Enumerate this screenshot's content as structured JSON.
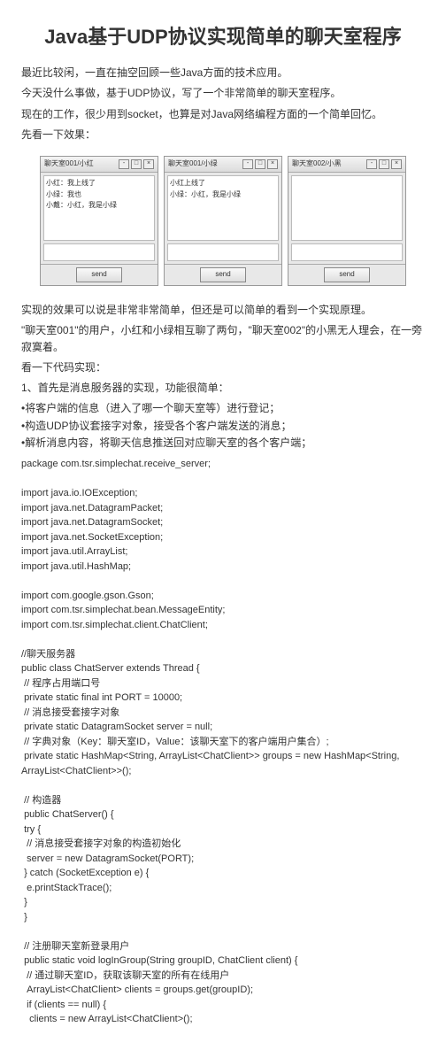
{
  "title": "Java基于UDP协议实现简单的聊天室程序",
  "intro": [
    "最近比较闲，一直在抽空回顾一些Java方面的技术应用。",
    "今天没什么事做，基于UDP协议，写了一个非常简单的聊天室程序。",
    "现在的工作，很少用到socket，也算是对Java网络编程方面的一个简单回忆。",
    "先看一下效果："
  ],
  "wins": [
    {
      "title": "聊天室001/小红",
      "lines": [
        "小红：我上线了",
        "小绿：我也",
        "小戴：小红，我是小绿"
      ]
    },
    {
      "title": "聊天室001/小绿",
      "lines": [
        "小红上线了",
        "小绿：小红，我是小绿"
      ]
    },
    {
      "title": "聊天室002/小黑",
      "lines": [
        ""
      ]
    }
  ],
  "sendLabel": "send",
  "after": [
    "实现的效果可以说是非常非常简单，但还是可以简单的看到一个实现原理。",
    "\"聊天室001\"的用户，小红和小绿相互聊了两句，\"聊天室002\"的小黑无人理会，在一旁寂寞着。",
    "看一下代码实现：",
    "1、首先是消息服务器的实现，功能很简单：",
    "•将客户端的信息（进入了哪一个聊天室等）进行登记；\n•构造UDP协议套接字对象，接受各个客户端发送的消息；\n•解析消息内容，将聊天信息推送回对应聊天室的各个客户端；"
  ],
  "code": "package com.tsr.simplechat.receive_server;\n\nimport java.io.IOException;\nimport java.net.DatagramPacket;\nimport java.net.DatagramSocket;\nimport java.net.SocketException;\nimport java.util.ArrayList;\nimport java.util.HashMap;\n\nimport com.google.gson.Gson;\nimport com.tsr.simplechat.bean.MessageEntity;\nimport com.tsr.simplechat.client.ChatClient;\n\n//聊天服务器\npublic class ChatServer extends Thread {\n // 程序占用端口号\n private static final int PORT = 10000;\n // 消息接受套接字对象\n private static DatagramSocket server = null;\n // 字典对象（Key：聊天室ID，Value：该聊天室下的客户端用户集合）;\n private static HashMap<String, ArrayList<ChatClient>> groups = new HashMap<String, ArrayList<ChatClient>>();\n\n // 构造器\n public ChatServer() {\n try {\n  // 消息接受套接字对象的构造初始化\n  server = new DatagramSocket(PORT);\n } catch (SocketException e) {\n  e.printStackTrace();\n }\n }\n\n // 注册聊天室新登录用户\n public static void logInGroup(String groupID, ChatClient client) {\n  // 通过聊天室ID，获取该聊天室的所有在线用户\n  ArrayList<ChatClient> clients = groups.get(groupID);\n  if (clients == null) {\n   clients = new ArrayList<ChatClient>();"
}
